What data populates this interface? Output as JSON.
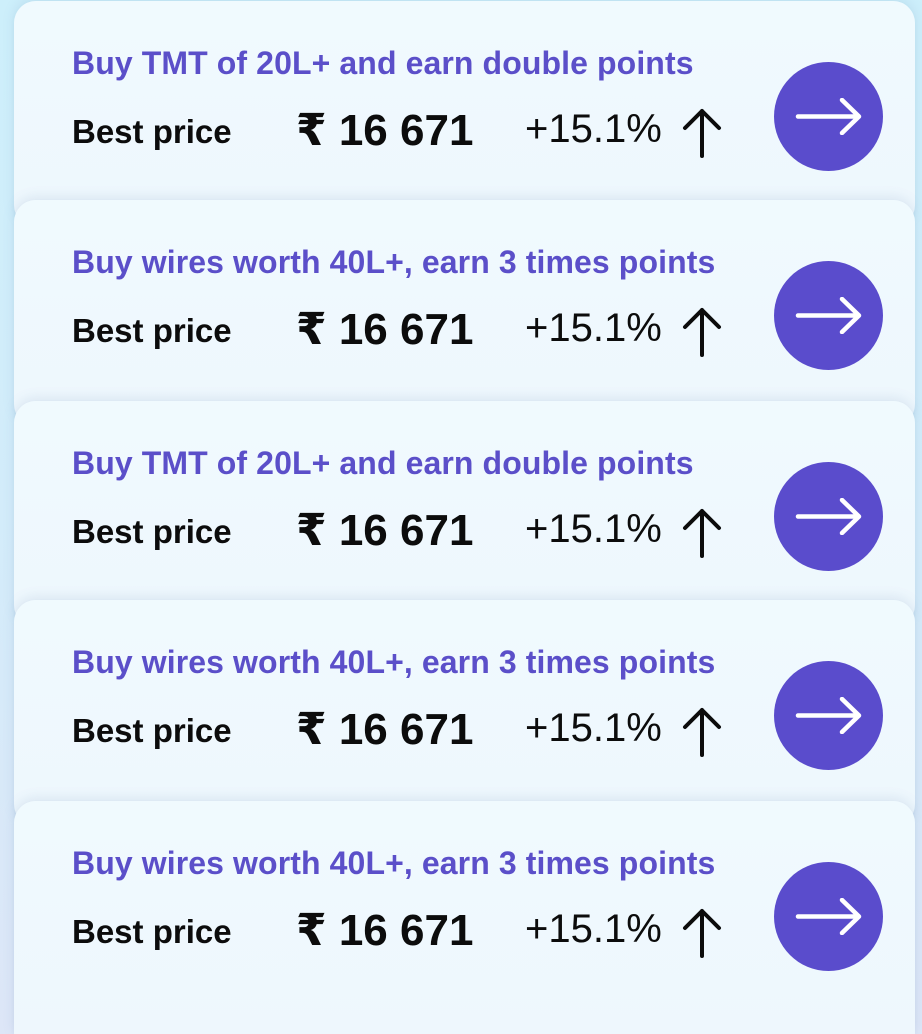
{
  "offers": [
    {
      "title": "Buy TMT of 20L+ and earn double points",
      "price_label": "Best price",
      "price": "₹ 16 671",
      "change": "+15.1%",
      "trend_icon": "up-arrow-icon",
      "action_icon": "right-arrow-icon"
    },
    {
      "title": "Buy wires worth 40L+, earn 3 times points",
      "price_label": "Best price",
      "price": "₹ 16 671",
      "change": "+15.1%",
      "trend_icon": "up-arrow-icon",
      "action_icon": "right-arrow-icon"
    },
    {
      "title": "Buy TMT of 20L+ and earn double points",
      "price_label": "Best price",
      "price": "₹ 16 671",
      "change": "+15.1%",
      "trend_icon": "up-arrow-icon",
      "action_icon": "right-arrow-icon"
    },
    {
      "title": "Buy wires worth 40L+, earn 3 times points",
      "price_label": "Best price",
      "price": "₹ 16 671",
      "change": "+15.1%",
      "trend_icon": "up-arrow-icon",
      "action_icon": "right-arrow-icon"
    },
    {
      "title": "Buy wires worth 40L+, earn 3 times points",
      "price_label": "Best price",
      "price": "₹ 16 671",
      "change": "+15.1%",
      "trend_icon": "up-arrow-icon",
      "action_icon": "right-arrow-icon"
    }
  ],
  "colors": {
    "accent": "#5a4ccc",
    "title": "#5b4fc9",
    "text": "#0c0c0c",
    "card": "#f0fafe",
    "background": "#cdeffb"
  }
}
